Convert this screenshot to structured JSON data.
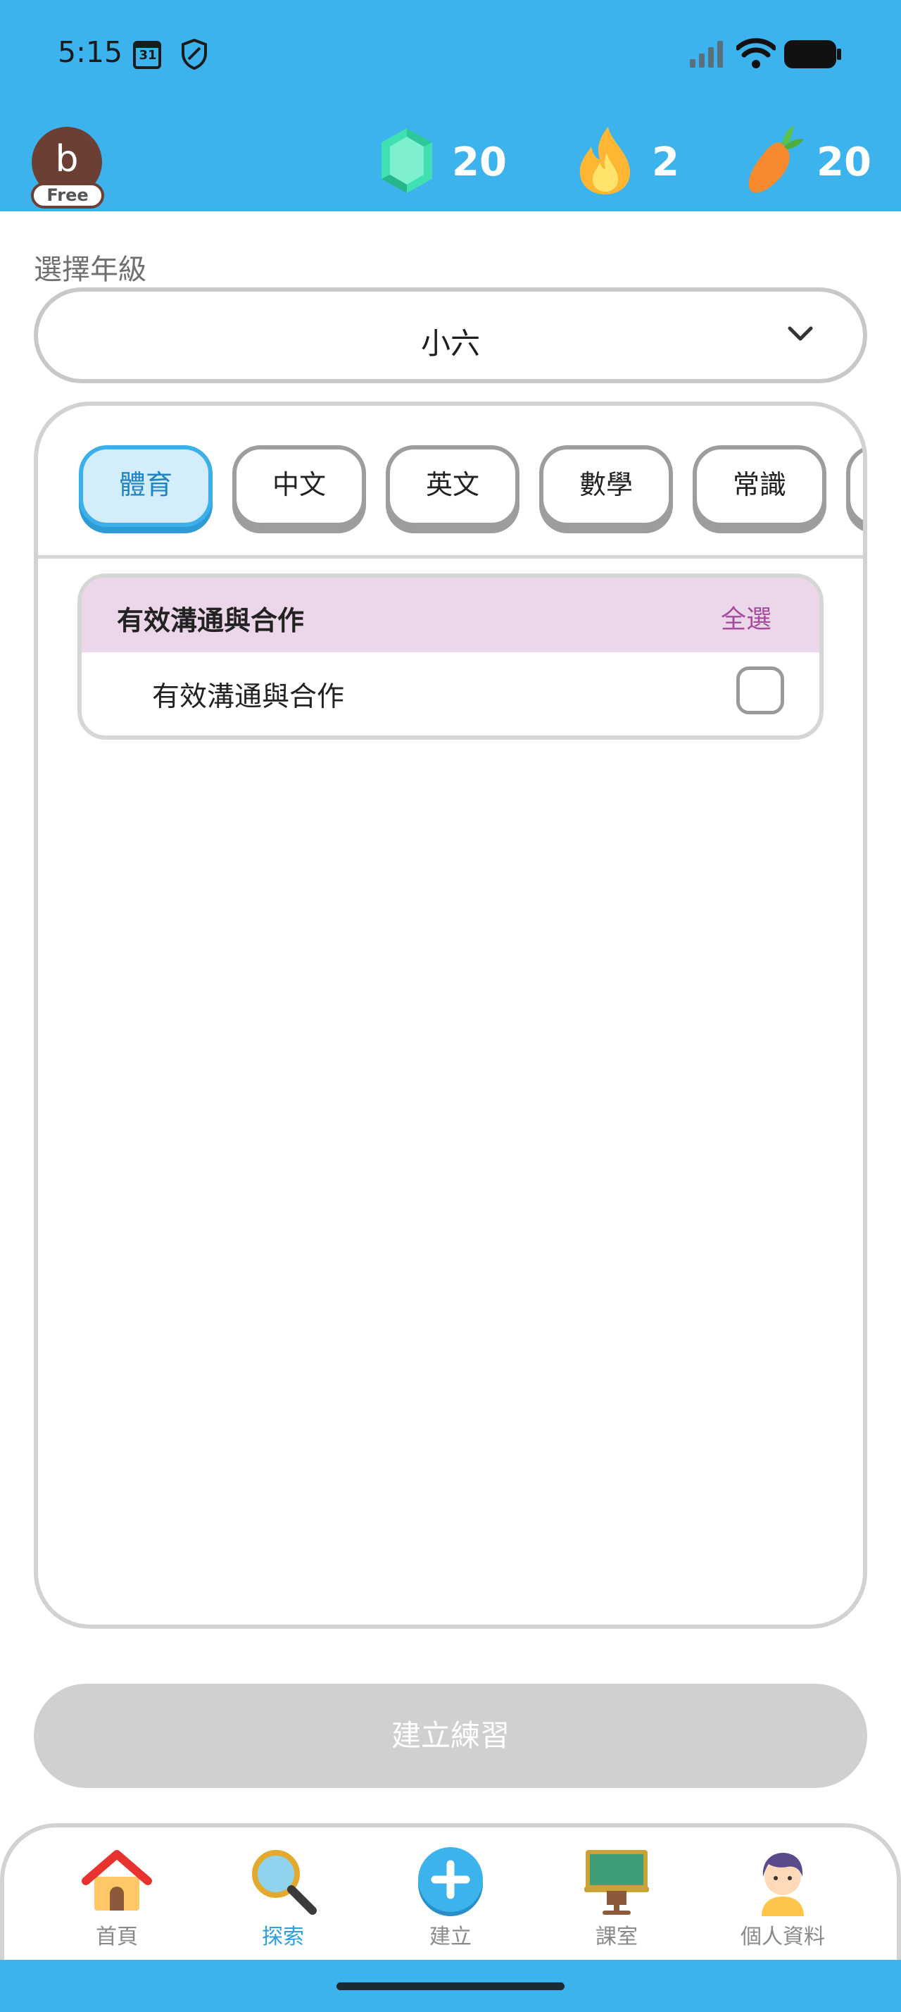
{
  "status_bar": {
    "time": "5:15",
    "calendar_day": "31"
  },
  "header": {
    "avatar_letter": "b",
    "plan_badge": "Free",
    "gems": "20",
    "streak": "2",
    "carrots": "20"
  },
  "grade": {
    "label": "選擇年級",
    "selected": "小六"
  },
  "subjects": {
    "tabs": [
      {
        "label": "體育",
        "active": true
      },
      {
        "label": "中文",
        "active": false
      },
      {
        "label": "英文",
        "active": false
      },
      {
        "label": "數學",
        "active": false
      },
      {
        "label": "常識",
        "active": false
      }
    ]
  },
  "topic_group": {
    "title": "有效溝通與合作",
    "select_all": "全選",
    "items": [
      {
        "label": "有效溝通與合作",
        "checked": false
      }
    ]
  },
  "create_button": "建立練習",
  "bottom_nav": {
    "items": [
      {
        "label": "首頁",
        "icon": "home-icon"
      },
      {
        "label": "探索",
        "icon": "search-icon",
        "active": true
      },
      {
        "label": "建立",
        "icon": "add-icon"
      },
      {
        "label": "課室",
        "icon": "classroom-icon"
      },
      {
        "label": "個人資料",
        "icon": "profile-icon"
      }
    ]
  },
  "colors": {
    "brand_blue": "#3db3ee",
    "active_tab_fill": "#d4edfb",
    "section_header": "#ecd7ea",
    "select_all_text": "#a64b9c",
    "disabled_button": "#d0d0d0"
  }
}
